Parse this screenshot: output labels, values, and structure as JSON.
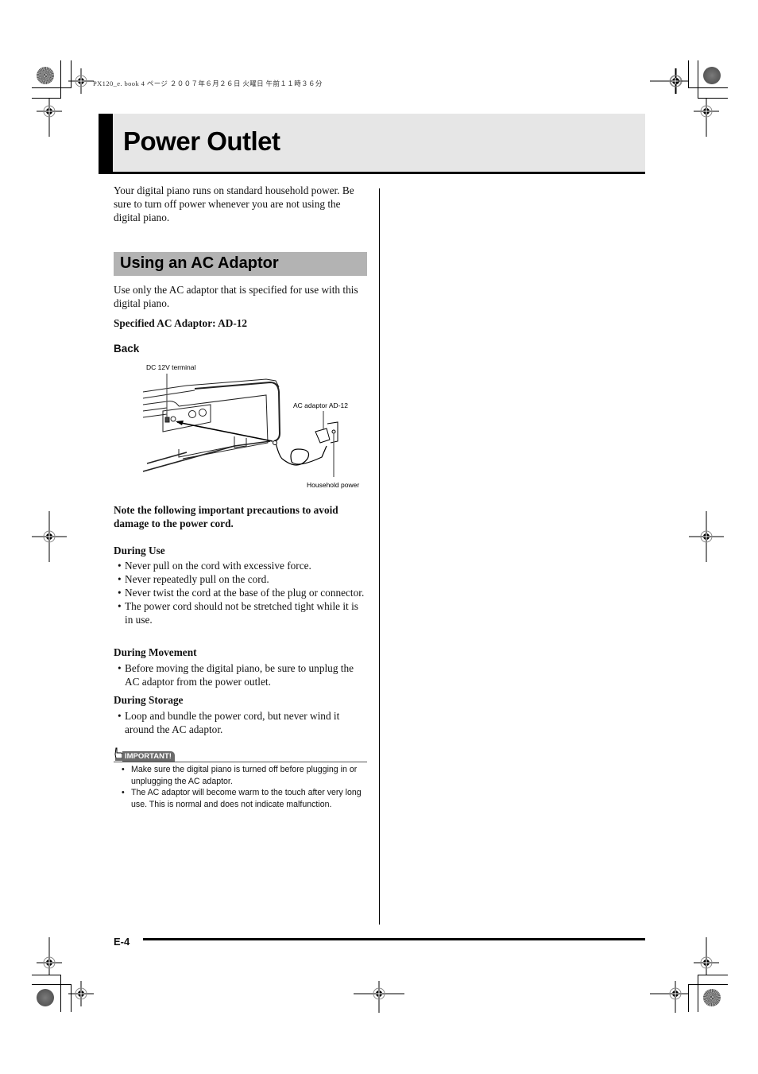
{
  "header": {
    "print_meta": "PX120_e. book  4 ページ  ２００７年６月２６日  火曜日  午前１１時３６分"
  },
  "page": {
    "title": "Power Outlet",
    "intro": "Your digital piano runs on standard household power. Be sure to turn off power whenever you are not using the digital piano.",
    "section": {
      "title": "Using an AC Adaptor",
      "body": "Use only the AC adaptor that is specified for use with this digital piano.",
      "specified": "Specified AC Adaptor: AD-12",
      "figure_heading": "Back",
      "figure_labels": {
        "terminal": "DC 12V terminal",
        "adaptor": "AC adaptor AD-12",
        "household": "Household power"
      },
      "precautions_intro": "Note the following important precautions to avoid damage to the power cord.",
      "groups": [
        {
          "heading": "During Use",
          "items": [
            "Never pull on the cord with excessive force.",
            "Never repeatedly pull on the cord.",
            "Never twist the cord at the base of the plug or connector.",
            "The power cord should not be stretched tight while it is in use."
          ]
        },
        {
          "heading": "During Movement",
          "items": [
            "Before moving the digital piano, be sure to unplug the AC adaptor from the power outlet."
          ]
        },
        {
          "heading": "During Storage",
          "items": [
            "Loop and bundle the power cord, but never wind it around the AC adaptor."
          ]
        }
      ],
      "important": {
        "label": "IMPORTANT!",
        "items": [
          "Make sure the digital piano is turned off before plugging in or unplugging the AC adaptor.",
          "The AC adaptor will become warm to the touch after very long use. This is normal and does not indicate malfunction."
        ]
      }
    }
  },
  "footer": {
    "page_number": "E-4"
  }
}
